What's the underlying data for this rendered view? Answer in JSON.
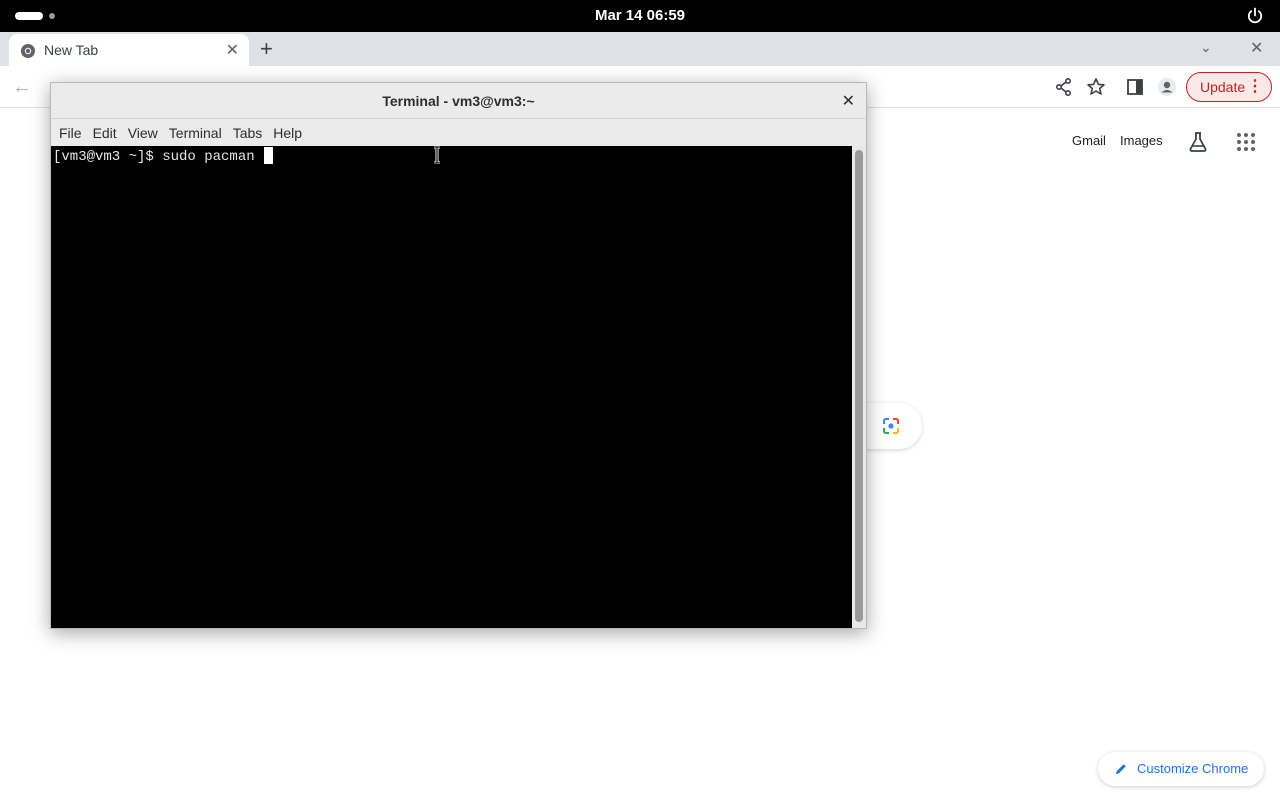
{
  "topbar": {
    "clock": "Mar 14  06:59",
    "icons": {
      "activities": "activities-indicator",
      "power": "power-icon"
    }
  },
  "chrome": {
    "tab": {
      "title": "New Tab",
      "favicon": "chrome-icon"
    },
    "toolbar": {
      "update_label": "Update"
    },
    "ntp": {
      "gmail": "Gmail",
      "images": "Images",
      "customize": "Customize Chrome"
    }
  },
  "terminal": {
    "title": "Terminal - vm3@vm3:~",
    "menu": [
      "File",
      "Edit",
      "View",
      "Terminal",
      "Tabs",
      "Help"
    ],
    "line": "[vm3@vm3 ~]$ sudo pacman "
  }
}
